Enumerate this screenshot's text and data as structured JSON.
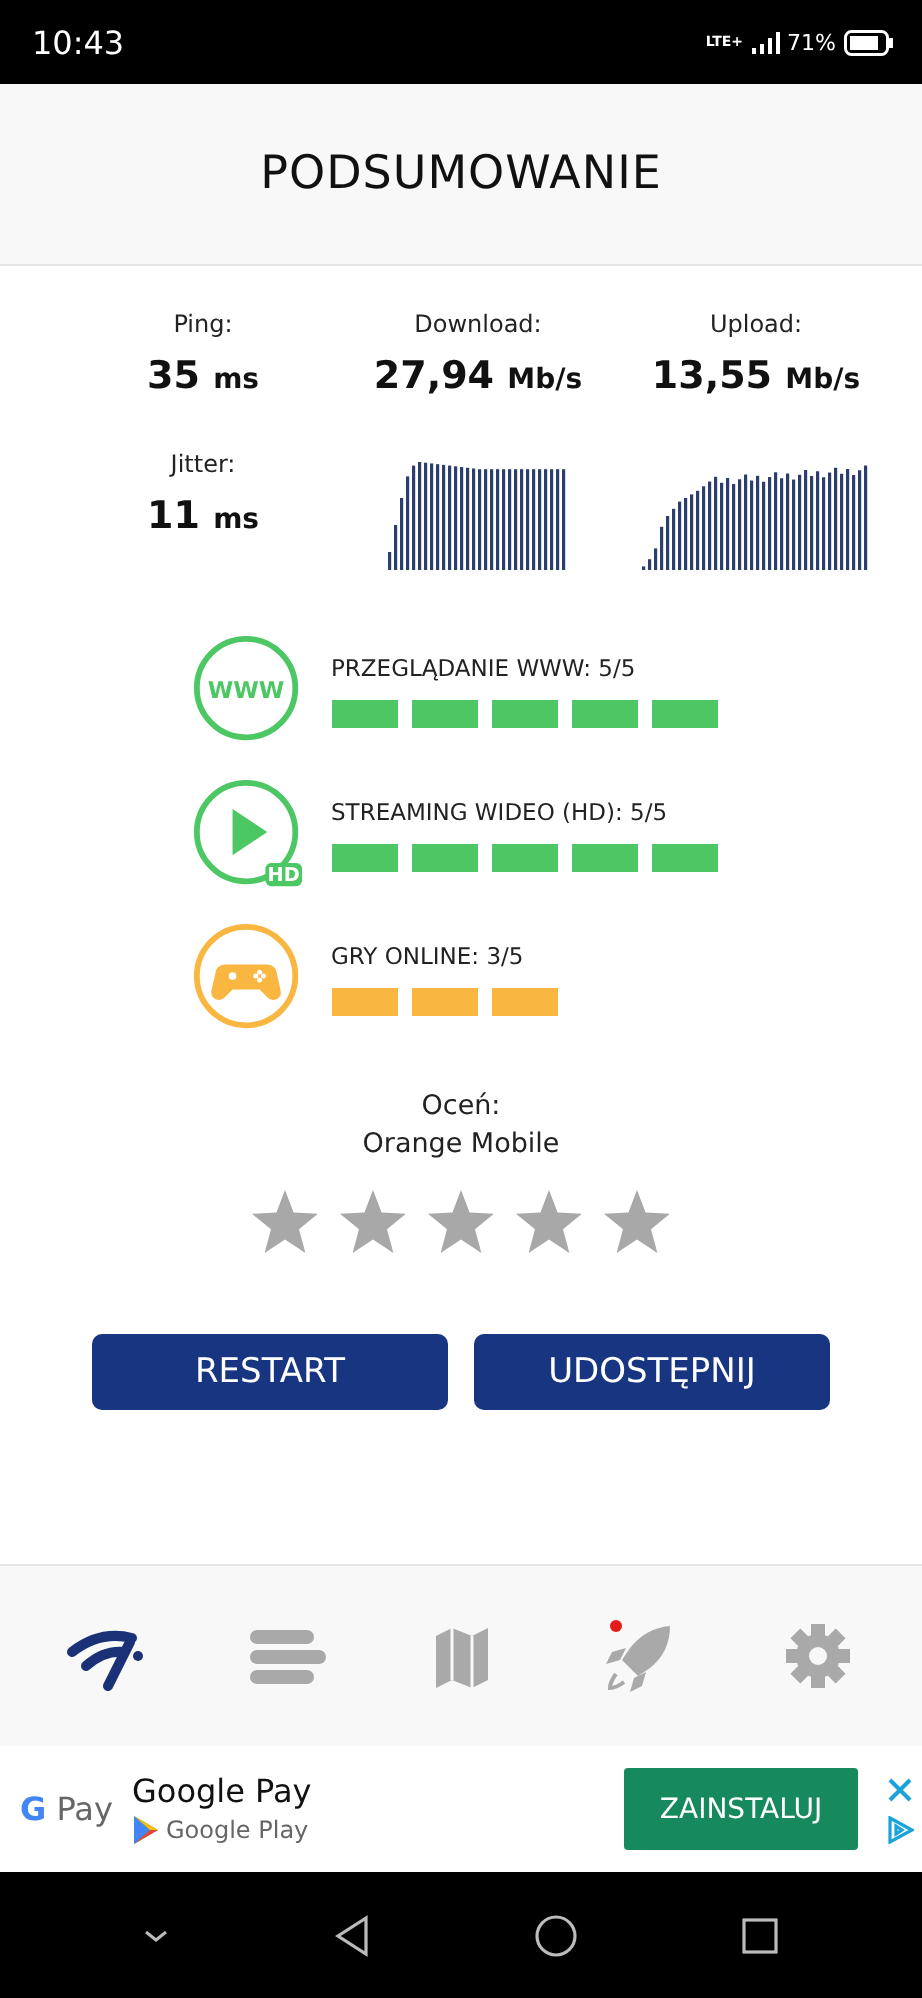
{
  "status_bar": {
    "time": "10:43",
    "network": "LTE+",
    "battery": "71%"
  },
  "header": {
    "title": "PODSUMOWANIE"
  },
  "stats": [
    {
      "label": "Ping:",
      "value": "35",
      "unit": "ms"
    },
    {
      "label": "Download:",
      "value": "27,94",
      "unit": "Mb/s"
    },
    {
      "label": "Upload:",
      "value": "13,55",
      "unit": "Mb/s"
    },
    {
      "label": "Jitter:",
      "value": "11",
      "unit": "ms"
    }
  ],
  "quality": [
    {
      "kind": "www",
      "icon_text": "WWW",
      "label": "PRZEGLĄDANIE WWW: 5/5",
      "stars": 5,
      "color": "#4cc764"
    },
    {
      "kind": "video",
      "label": "STREAMING WIDEO (HD): 5/5",
      "stars": 5,
      "color": "#4cc764",
      "badge": "HD"
    },
    {
      "kind": "games",
      "label": "GRY ONLINE: 3/5",
      "stars": 3,
      "color": "#f9b640"
    }
  ],
  "rating": {
    "prompt": "Oceń:",
    "operator": "Orange Mobile",
    "stars": 0
  },
  "buttons": [
    "RESTART",
    "UDOSTĘPNIJ"
  ],
  "nav": [
    {
      "kind": "speed",
      "selected": true,
      "notification": false
    },
    {
      "kind": "history",
      "selected": false,
      "notification": false
    },
    {
      "kind": "map",
      "selected": false,
      "notification": false
    },
    {
      "kind": "boost",
      "selected": false,
      "notification": true
    },
    {
      "kind": "settings",
      "selected": false,
      "notification": false
    }
  ],
  "ad": {
    "logo_mark": "G",
    "logo": "Pay",
    "title": "Google Pay",
    "store": "Google Play",
    "button": "ZAINSTALUJ"
  }
}
